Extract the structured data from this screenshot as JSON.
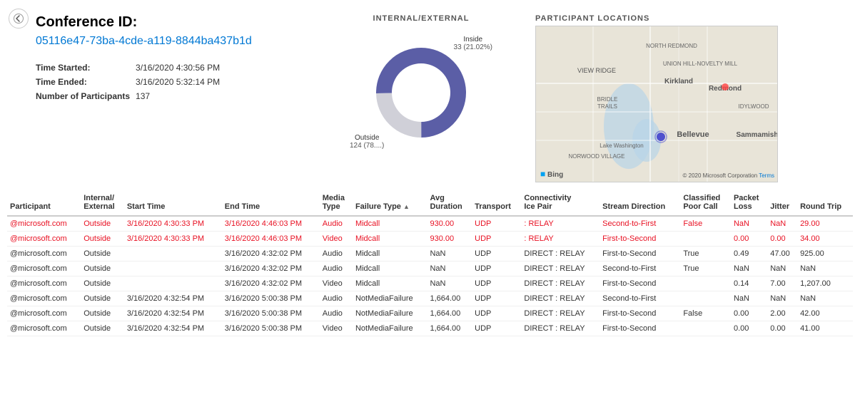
{
  "back_button": "←",
  "conference": {
    "id_label": "Conference ID:",
    "id_value": "05116e47-73ba-4cde-a119-8844ba437b1d",
    "time_started_label": "Time Started:",
    "time_started_value": "3/16/2020 4:30:56 PM",
    "time_ended_label": "Time Ended:",
    "time_ended_value": "3/16/2020 5:32:14 PM",
    "participants_label": "Number of Participants",
    "participants_value": "137"
  },
  "internal_external_chart": {
    "title": "INTERNAL/EXTERNAL",
    "inside_label": "Inside",
    "inside_value": "33 (21.02%)",
    "outside_label": "Outside",
    "outside_value": "124 (78....)",
    "inside_percent": 21,
    "outside_percent": 79
  },
  "participant_locations": {
    "title": "PARTICIPANT LOCATIONS"
  },
  "table": {
    "columns": [
      {
        "key": "participant",
        "label": "Participant"
      },
      {
        "key": "internal_external",
        "label": "Internal/\nExternal"
      },
      {
        "key": "start_time",
        "label": "Start Time"
      },
      {
        "key": "end_time",
        "label": "End Time"
      },
      {
        "key": "media_type",
        "label": "Media\nType"
      },
      {
        "key": "failure_type",
        "label": "Failure Type",
        "sort": "asc"
      },
      {
        "key": "avg_duration",
        "label": "Avg\nDuration"
      },
      {
        "key": "transport",
        "label": "Transport"
      },
      {
        "key": "connectivity_ice_pair",
        "label": "Connectivity\nIce Pair"
      },
      {
        "key": "stream_direction",
        "label": "Stream Direction"
      },
      {
        "key": "classified_poor_call",
        "label": "Classified\nPoor Call"
      },
      {
        "key": "packet_loss",
        "label": "Packet\nLoss"
      },
      {
        "key": "jitter",
        "label": "Jitter"
      },
      {
        "key": "round_trip",
        "label": "Round Trip"
      }
    ],
    "rows": [
      {
        "participant": "@microsoft.com",
        "internal_external": "Outside",
        "start_time": "3/16/2020 4:30:33 PM",
        "end_time": "3/16/2020 4:46:03 PM",
        "media_type": "Audio",
        "failure_type": "Midcall",
        "avg_duration": "930.00",
        "transport": "UDP",
        "connectivity_ice_pair": ": RELAY",
        "stream_direction": "Second-to-First",
        "classified_poor_call": "False",
        "packet_loss": "NaN",
        "jitter": "NaN",
        "round_trip": "29.00",
        "highlight": true
      },
      {
        "participant": "@microsoft.com",
        "internal_external": "Outside",
        "start_time": "3/16/2020 4:30:33 PM",
        "end_time": "3/16/2020 4:46:03 PM",
        "media_type": "Video",
        "failure_type": "Midcall",
        "avg_duration": "930.00",
        "transport": "UDP",
        "connectivity_ice_pair": ": RELAY",
        "stream_direction": "First-to-Second",
        "classified_poor_call": "",
        "packet_loss": "0.00",
        "jitter": "0.00",
        "round_trip": "34.00",
        "highlight": true
      },
      {
        "participant": "@microsoft.com",
        "internal_external": "Outside",
        "start_time": "",
        "end_time": "3/16/2020 4:32:02 PM",
        "media_type": "Audio",
        "failure_type": "Midcall",
        "avg_duration": "NaN",
        "transport": "UDP",
        "connectivity_ice_pair": "DIRECT : RELAY",
        "stream_direction": "First-to-Second",
        "classified_poor_call": "True",
        "packet_loss": "0.49",
        "jitter": "47.00",
        "round_trip": "925.00",
        "highlight": false
      },
      {
        "participant": "@microsoft.com",
        "internal_external": "Outside",
        "start_time": "",
        "end_time": "3/16/2020 4:32:02 PM",
        "media_type": "Audio",
        "failure_type": "Midcall",
        "avg_duration": "NaN",
        "transport": "UDP",
        "connectivity_ice_pair": "DIRECT : RELAY",
        "stream_direction": "Second-to-First",
        "classified_poor_call": "True",
        "packet_loss": "NaN",
        "jitter": "NaN",
        "round_trip": "NaN",
        "highlight": false
      },
      {
        "participant": "@microsoft.com",
        "internal_external": "Outside",
        "start_time": "",
        "end_time": "3/16/2020 4:32:02 PM",
        "media_type": "Video",
        "failure_type": "Midcall",
        "avg_duration": "NaN",
        "transport": "UDP",
        "connectivity_ice_pair": "DIRECT : RELAY",
        "stream_direction": "First-to-Second",
        "classified_poor_call": "",
        "packet_loss": "0.14",
        "jitter": "7.00",
        "round_trip": "1,207.00",
        "highlight": false
      },
      {
        "participant": "@microsoft.com",
        "internal_external": "Outside",
        "start_time": "3/16/2020 4:32:54 PM",
        "end_time": "3/16/2020 5:00:38 PM",
        "media_type": "Audio",
        "failure_type": "NotMediaFailure",
        "avg_duration": "1,664.00",
        "transport": "UDP",
        "connectivity_ice_pair": "DIRECT : RELAY",
        "stream_direction": "Second-to-First",
        "classified_poor_call": "",
        "packet_loss": "NaN",
        "jitter": "NaN",
        "round_trip": "NaN",
        "highlight": false
      },
      {
        "participant": "@microsoft.com",
        "internal_external": "Outside",
        "start_time": "3/16/2020 4:32:54 PM",
        "end_time": "3/16/2020 5:00:38 PM",
        "media_type": "Audio",
        "failure_type": "NotMediaFailure",
        "avg_duration": "1,664.00",
        "transport": "UDP",
        "connectivity_ice_pair": "DIRECT : RELAY",
        "stream_direction": "First-to-Second",
        "classified_poor_call": "False",
        "packet_loss": "0.00",
        "jitter": "2.00",
        "round_trip": "42.00",
        "highlight": false
      },
      {
        "participant": "@microsoft.com",
        "internal_external": "Outside",
        "start_time": "3/16/2020 4:32:54 PM",
        "end_time": "3/16/2020 5:00:38 PM",
        "media_type": "Video",
        "failure_type": "NotMediaFailure",
        "avg_duration": "1,664.00",
        "transport": "UDP",
        "connectivity_ice_pair": "DIRECT : RELAY",
        "stream_direction": "First-to-Second",
        "classified_poor_call": "",
        "packet_loss": "0.00",
        "jitter": "0.00",
        "round_trip": "41.00",
        "highlight": false
      }
    ]
  }
}
